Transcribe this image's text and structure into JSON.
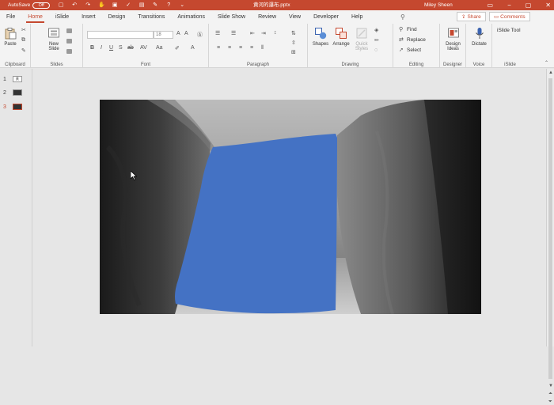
{
  "titlebar": {
    "autosave_label": "AutoSave",
    "autosave_state": "Off",
    "doc_title": "黄河的瀑布.pptx",
    "user_name": "Miley Sheen"
  },
  "tabs": [
    "File",
    "Home",
    "iSlide",
    "Insert",
    "Design",
    "Transitions",
    "Animations",
    "Slide Show",
    "Review",
    "View",
    "Developer",
    "Help"
  ],
  "active_tab": "Home",
  "toolbar": {
    "tell_me": "",
    "share_label": "Share",
    "comments_label": "Comments"
  },
  "ribbon": {
    "clipboard": {
      "paste": "Paste",
      "label": "Clipboard"
    },
    "slides": {
      "new_slide_line1": "New",
      "new_slide_line2": "Slide",
      "label": "Slides"
    },
    "font": {
      "font_name": "",
      "font_size": "18",
      "label": "Font"
    },
    "paragraph": {
      "label": "Paragraph"
    },
    "drawing": {
      "shapes": "Shapes",
      "arrange": "Arrange",
      "quick_styles_1": "Quick",
      "quick_styles_2": "Styles",
      "label": "Drawing"
    },
    "editing": {
      "find": "Find",
      "replace": "Replace",
      "select": "Select",
      "label": "Editing"
    },
    "designer": {
      "design_ideas_1": "Design",
      "design_ideas_2": "Ideas",
      "label": "Designer"
    },
    "voice": {
      "dictate": "Dictate",
      "label": "Voice"
    },
    "islide": {
      "tool": "iSlide Tool",
      "label": "iSlide"
    }
  },
  "slides_pane": [
    {
      "number": "1",
      "preview": "黄"
    },
    {
      "number": "2",
      "preview": ""
    },
    {
      "number": "3",
      "preview": ""
    }
  ],
  "colors": {
    "accent": "#c5482f",
    "shape_fill": "#4472c4"
  }
}
